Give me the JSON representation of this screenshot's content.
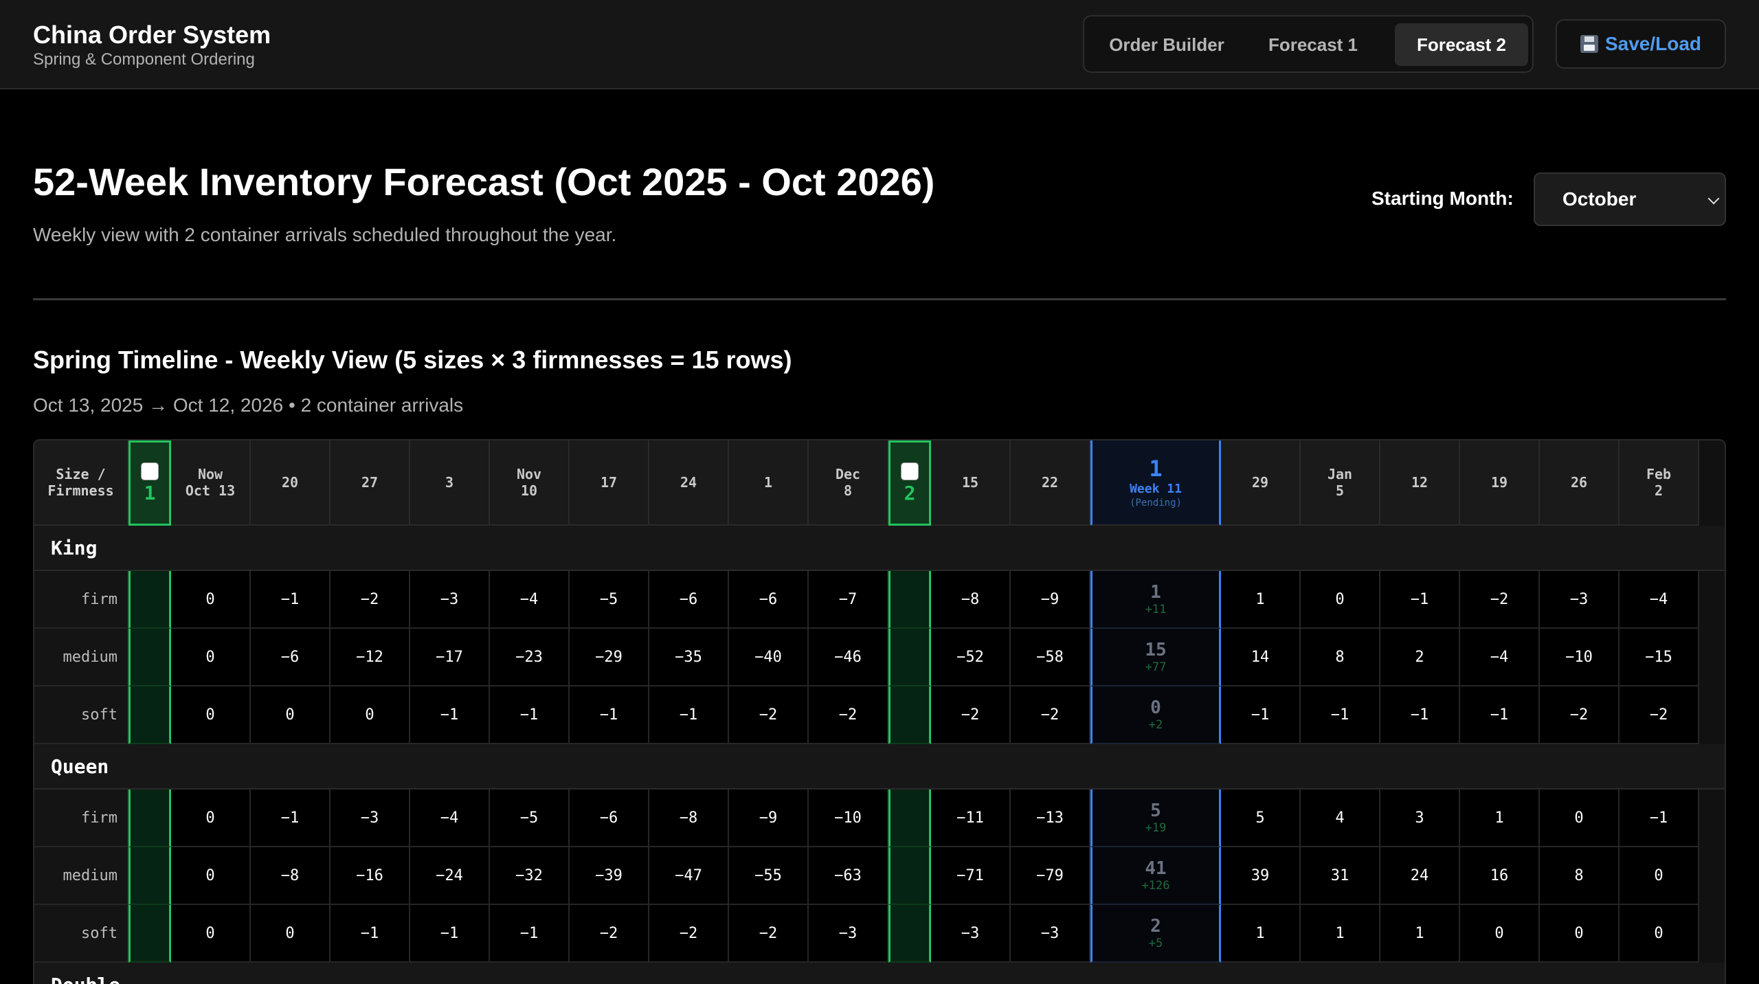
{
  "app": {
    "title": "China Order System",
    "subtitle": "Spring & Component Ordering"
  },
  "nav": {
    "tabs": [
      {
        "label": "Order Builder",
        "active": false
      },
      {
        "label": "Forecast 1",
        "active": false
      },
      {
        "label": "Forecast 2",
        "active": true
      }
    ],
    "save_load_label": "Save/Load",
    "save_load_icon": "floppy-disk-icon"
  },
  "page": {
    "title": "52-Week Inventory Forecast (Oct 2025 - Oct 2026)",
    "description": "Weekly view with 2 container arrivals scheduled throughout the year.",
    "starting_month_label": "Starting Month:",
    "starting_month_value": "October"
  },
  "timeline": {
    "title": "Spring Timeline - Weekly View (5 sizes × 3 firmnesses = 15 rows)",
    "subtitle": "Oct 13, 2025 → Oct 12, 2026 • 2 container arrivals",
    "corner_label_1": "Size /",
    "corner_label_2": "Firmness",
    "columns": [
      {
        "kind": "container",
        "number": "1"
      },
      {
        "kind": "week",
        "line1": "Now",
        "line2": "Oct 13"
      },
      {
        "kind": "week",
        "line1": "",
        "line2": "20"
      },
      {
        "kind": "week",
        "line1": "",
        "line2": "27"
      },
      {
        "kind": "week",
        "line1": "",
        "line2": "3"
      },
      {
        "kind": "week",
        "line1": "Nov",
        "line2": "10"
      },
      {
        "kind": "week",
        "line1": "",
        "line2": "17"
      },
      {
        "kind": "week",
        "line1": "",
        "line2": "24"
      },
      {
        "kind": "week",
        "line1": "",
        "line2": "1"
      },
      {
        "kind": "week",
        "line1": "Dec",
        "line2": "8"
      },
      {
        "kind": "container",
        "number": "2"
      },
      {
        "kind": "week",
        "line1": "",
        "line2": "15"
      },
      {
        "kind": "week",
        "line1": "",
        "line2": "22"
      },
      {
        "kind": "pending",
        "number": "1",
        "week": "Week 11",
        "status": "(Pending)"
      },
      {
        "kind": "week",
        "line1": "",
        "line2": "29"
      },
      {
        "kind": "week",
        "line1": "Jan",
        "line2": "5"
      },
      {
        "kind": "week",
        "line1": "",
        "line2": "12"
      },
      {
        "kind": "week",
        "line1": "",
        "line2": "19"
      },
      {
        "kind": "week",
        "line1": "",
        "line2": "26"
      },
      {
        "kind": "week",
        "line1": "Feb",
        "line2": "2"
      }
    ],
    "groups": [
      {
        "size": "King",
        "rows": [
          {
            "firmness": "firm",
            "values": [
              "0",
              "−1",
              "−2",
              "−3",
              "−4",
              "−5",
              "−6",
              "−6",
              "−7",
              "−8",
              "−9",
              "1",
              "1",
              "0",
              "−1",
              "−2",
              "−3",
              "−4"
            ],
            "pending_delta": "+11"
          },
          {
            "firmness": "medium",
            "values": [
              "0",
              "−6",
              "−12",
              "−17",
              "−23",
              "−29",
              "−35",
              "−40",
              "−46",
              "−52",
              "−58",
              "15",
              "14",
              "8",
              "2",
              "−4",
              "−10",
              "−15"
            ],
            "pending_delta": "+77"
          },
          {
            "firmness": "soft",
            "values": [
              "0",
              "0",
              "0",
              "−1",
              "−1",
              "−1",
              "−1",
              "−2",
              "−2",
              "−2",
              "−2",
              "0",
              "−1",
              "−1",
              "−1",
              "−1",
              "−2",
              "−2"
            ],
            "pending_delta": "+2"
          }
        ]
      },
      {
        "size": "Queen",
        "rows": [
          {
            "firmness": "firm",
            "values": [
              "0",
              "−1",
              "−3",
              "−4",
              "−5",
              "−6",
              "−8",
              "−9",
              "−10",
              "−11",
              "−13",
              "5",
              "5",
              "4",
              "3",
              "1",
              "0",
              "−1"
            ],
            "pending_delta": "+19"
          },
          {
            "firmness": "medium",
            "values": [
              "0",
              "−8",
              "−16",
              "−24",
              "−32",
              "−39",
              "−47",
              "−55",
              "−63",
              "−71",
              "−79",
              "41",
              "39",
              "31",
              "24",
              "16",
              "8",
              "0"
            ],
            "pending_delta": "+126"
          },
          {
            "firmness": "soft",
            "values": [
              "0",
              "0",
              "−1",
              "−1",
              "−1",
              "−2",
              "−2",
              "−2",
              "−3",
              "−3",
              "−3",
              "2",
              "1",
              "1",
              "1",
              "0",
              "0",
              "0"
            ],
            "pending_delta": "+5"
          }
        ]
      },
      {
        "size": "Double",
        "rows": []
      }
    ]
  },
  "colors": {
    "container_accent": "#22c55e",
    "pending_accent": "#3b82f6",
    "link_blue": "#4f9cf0"
  }
}
